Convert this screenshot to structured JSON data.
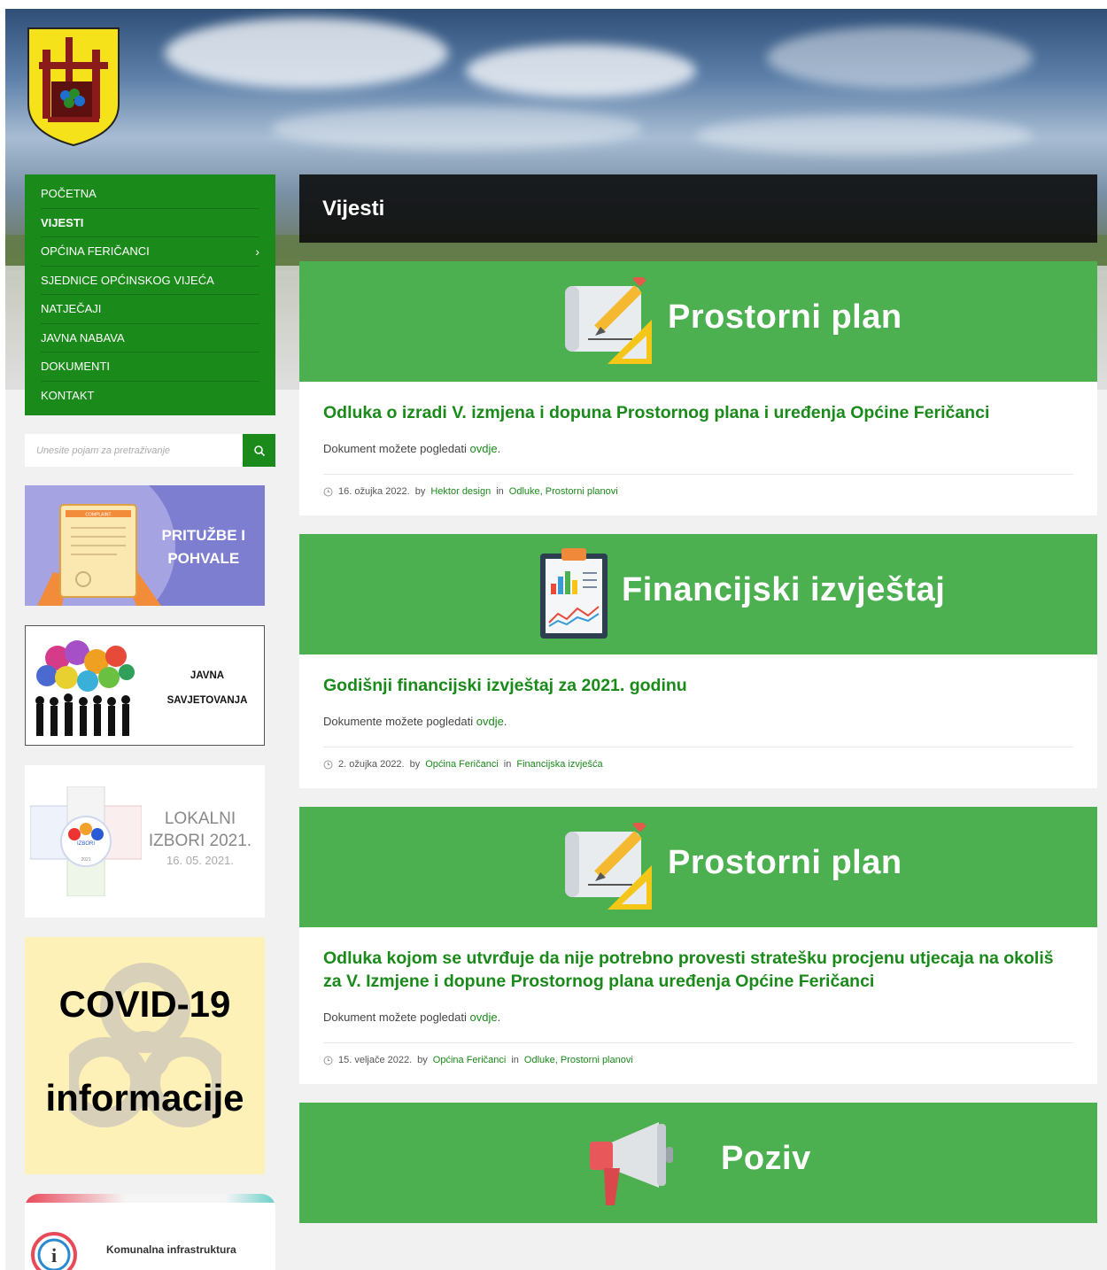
{
  "nav": [
    {
      "label": "POČETNA",
      "active": false,
      "has_sub": false
    },
    {
      "label": "VIJESTI",
      "active": true,
      "has_sub": false
    },
    {
      "label": "OPĆINA FERIČANCI",
      "active": false,
      "has_sub": true
    },
    {
      "label": "SJEDNICE OPĆINSKOG VIJEĆA",
      "active": false,
      "has_sub": false
    },
    {
      "label": "NATJEČAJI",
      "active": false,
      "has_sub": false
    },
    {
      "label": "JAVNA NABAVA",
      "active": false,
      "has_sub": false
    },
    {
      "label": "DOKUMENTI",
      "active": false,
      "has_sub": false
    },
    {
      "label": "KONTAKT",
      "active": false,
      "has_sub": false
    }
  ],
  "nav_chevron": "›",
  "search": {
    "placeholder": "Unesite pojam za pretraživanje"
  },
  "banners": {
    "prituzbe": {
      "line1": "PRITUŽBE I",
      "line2": "POHVALE",
      "doc_label": "COMPLAINT"
    },
    "javna": {
      "line1": "JAVNA",
      "line2": "SAVJETOVANJA"
    },
    "lokalni": {
      "line1": "LOKALNI",
      "line2": "IZBORI 2021.",
      "date": "16. 05. 2021.",
      "badge": "IZBORI",
      "badge_year": "2021"
    },
    "covid": {
      "line1": "COVID-19",
      "line2": "informacije"
    },
    "komunalna": {
      "label": "Komunalna infrastruktura"
    }
  },
  "page_title": "Vijesti",
  "posts": [
    {
      "image_label": "Prostorni plan",
      "icon": "blueprint-icon",
      "title": "Odluka o izradi V. izmjena i dopuna Prostornog plana i uređenja Općine Feričanci",
      "text_before": "Dokument možete pogledati",
      "link": "ovdje",
      "text_after": ".",
      "date": "16. ožujka 2022.",
      "by_word": "by",
      "author": "Hektor design",
      "in_word": "in",
      "categories": "Odluke, Prostorni planovi"
    },
    {
      "image_label": "Financijski izvještaj",
      "icon": "clipboard-chart-icon",
      "title": "Godišnji financijski izvještaj za 2021. godinu",
      "text_before": "Dokumente možete pogledati",
      "link": "ovdje",
      "text_after": ".",
      "date": "2. ožujka 2022.",
      "by_word": "by",
      "author": "Općina Feričanci",
      "in_word": "in",
      "categories": "Financijska izvješća"
    },
    {
      "image_label": "Prostorni plan",
      "icon": "blueprint-icon",
      "title": "Odluka kojom se utvrđuje da nije potrebno provesti stratešku procjenu utjecaja na okoliš za V. Izmjene i dopune Prostornog plana uređenja Općine Feričanci",
      "text_before": "Dokument možete pogledati",
      "link": "ovdje",
      "text_after": ".",
      "date": "15. veljače 2022.",
      "by_word": "by",
      "author": "Općina Feričanci",
      "in_word": "in",
      "categories": "Odluke, Prostorni planovi"
    },
    {
      "image_label": "Poziv",
      "icon": "megaphone-icon"
    }
  ],
  "colors": {
    "brand_green": "#1a8a1a",
    "post_image_green": "#4caf50"
  }
}
